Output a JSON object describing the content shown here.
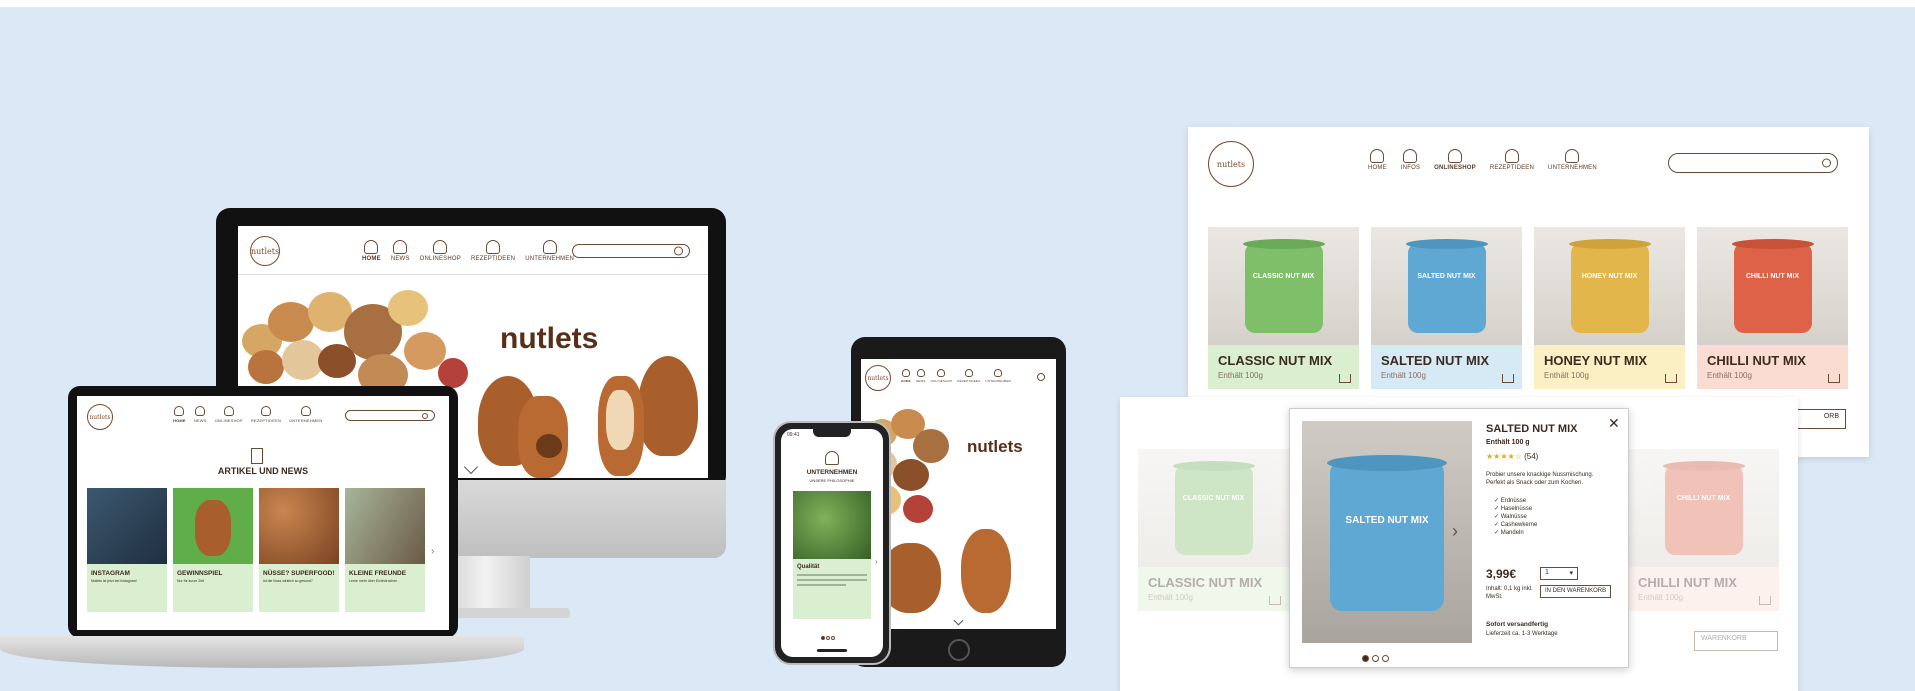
{
  "brand": "nutlets",
  "nav": {
    "home": "HOME",
    "infos": "INFOS",
    "news": "NEWS",
    "onlineshop": "ONLINESHOP",
    "rezeptideen": "REZEPTIDEEN",
    "unternehmen": "UNTERNEHMEN"
  },
  "laptop": {
    "section_title": "ARTIKEL UND NEWS",
    "tiles": [
      {
        "title": "INSTAGRAM",
        "text": "Nutlets ist jetzt bei Instagram!"
      },
      {
        "title": "GEWINNSPIEL",
        "text": "Nur für kurze Zeit"
      },
      {
        "title": "NÜSSE? SUPERFOOD!",
        "text": "Ist die Nuss wirklich so gesund?"
      },
      {
        "title": "KLEINE FREUNDE",
        "text": "Lerne mehr über Eichhörnchen"
      }
    ]
  },
  "phone": {
    "time": "09:41",
    "heading": "UNTERNEHMEN",
    "subheading": "UNSERE PHILOSOPHIE",
    "card_title": "Qualität"
  },
  "shop": {
    "products": [
      {
        "name": "CLASSIC NUT MIX",
        "sub": "Enthält 100g",
        "can_label": "CLASSIC NUT MIX"
      },
      {
        "name": "SALTED NUT MIX",
        "sub": "Enthält 100g",
        "can_label": "SALTED NUT MIX"
      },
      {
        "name": "HONEY NUT MIX",
        "sub": "Enthält 100g",
        "can_label": "HONEY NUT MIX"
      },
      {
        "name": "CHILLI NUT MIX",
        "sub": "Enthält 100g",
        "can_label": "CHILLI NUT MIX"
      }
    ],
    "cart_label": "WARENKORB",
    "cart_label_partial": "ORB"
  },
  "modal": {
    "title": "SALTED NUT MIX",
    "subtitle": "Enthält 100 g",
    "rating": 4,
    "stars": "★★★★☆",
    "reviews": "(54)",
    "description": "Probier unsere knackige Nussmischung. Perfekt als Snack oder zum Kochen.",
    "ingredients": [
      "Erdnüsse",
      "Haselnüsse",
      "Walnüsse",
      "Cashewkerne",
      "Mandeln"
    ],
    "price": "3,99€",
    "qty": "1",
    "info": "Inhalt: 0,1 kg inkl. MwSt.",
    "add_to_cart": "IN DEN WARENKORB",
    "shipping_title": "Sofort versandfertig",
    "shipping_text": "Lieferzeit ca. 1-3 Werktage",
    "close": "✕"
  },
  "colors": {
    "background": "#dbe8f6",
    "brand_brown": "#7a4a2f",
    "green_tile": "#d9efcf",
    "blue_tile": "#d6eaf6",
    "yellow_tile": "#fbefc4",
    "red_tile": "#fbdcd2"
  }
}
